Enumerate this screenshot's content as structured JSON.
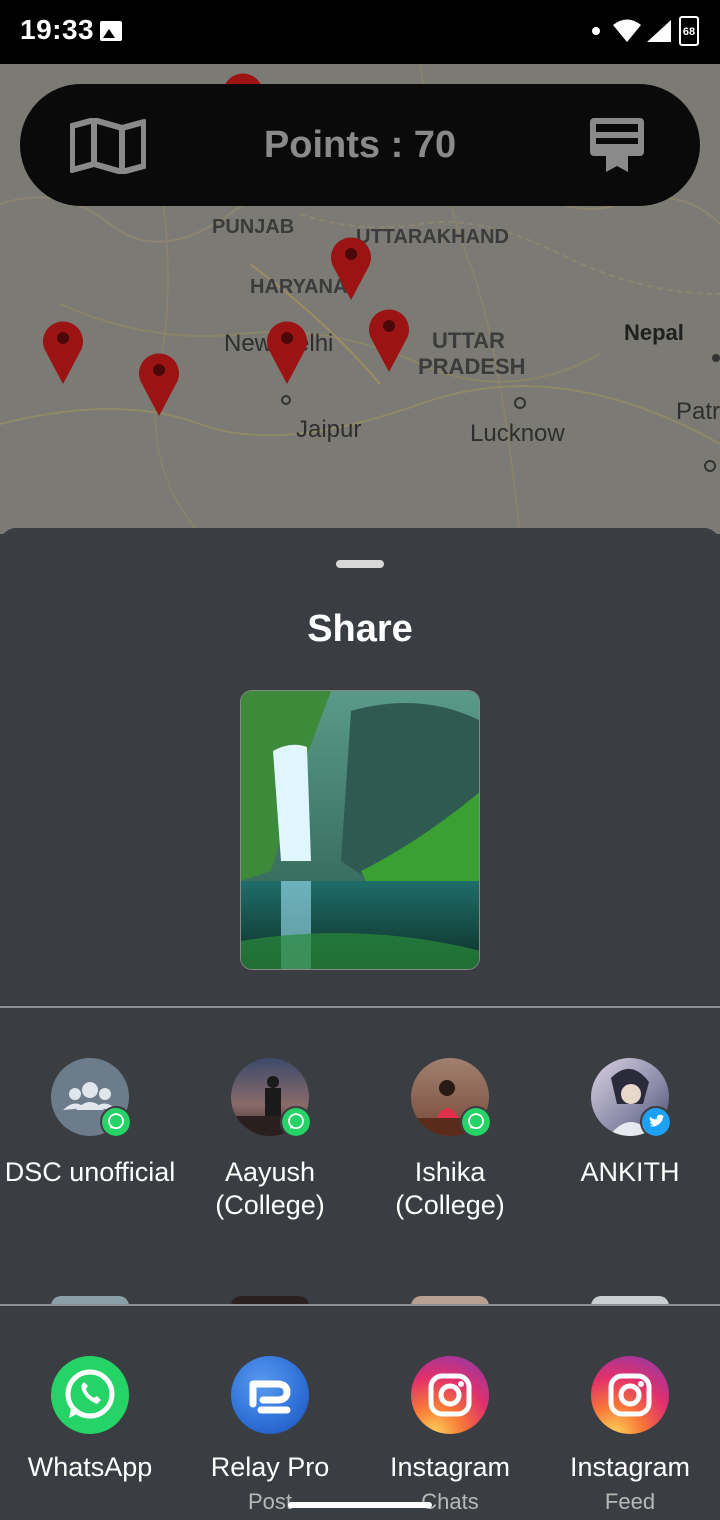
{
  "status_bar": {
    "time": "19:33",
    "battery": "68",
    "icons": [
      "image-icon",
      "dot-icon",
      "wifi-icon",
      "signal-icon",
      "battery-icon"
    ]
  },
  "map": {
    "labels": {
      "punjab": "PUNJAB",
      "uttarakhand": "UTTARAKHAND",
      "haryana": "HARYANA",
      "new_delhi": "New Delhi",
      "uttar": "UTTAR",
      "pradesh": "PRADESH",
      "nepal": "Nepal",
      "jaipur": "Jaipur",
      "lucknow": "Lucknow",
      "patna": "Patr"
    },
    "pin_color": "#9c1313"
  },
  "top_bar": {
    "points_text": "Points : 70",
    "left_icon": "map-icon",
    "right_icon": "leaderboard-icon"
  },
  "share_sheet": {
    "title": "Share",
    "preview_icon": "waterfall-image",
    "direct_targets": [
      {
        "name": "DSC unofficial",
        "badge": "whatsapp"
      },
      {
        "name": "Aayush (College)",
        "badge": "whatsapp"
      },
      {
        "name": "Ishika (College)",
        "badge": "whatsapp"
      },
      {
        "name": "ANKITH",
        "badge": "twitter"
      }
    ],
    "apps": [
      {
        "name": "WhatsApp",
        "sub": ""
      },
      {
        "name": "Relay Pro",
        "sub": "Post"
      },
      {
        "name": "Instagram",
        "sub": "Chats"
      },
      {
        "name": "Instagram",
        "sub": "Feed"
      }
    ]
  },
  "colors": {
    "sheet_bg": "#3a3d41",
    "whatsapp": "#25d366",
    "twitter": "#1da1f2",
    "relay": "#2e6fd6"
  }
}
